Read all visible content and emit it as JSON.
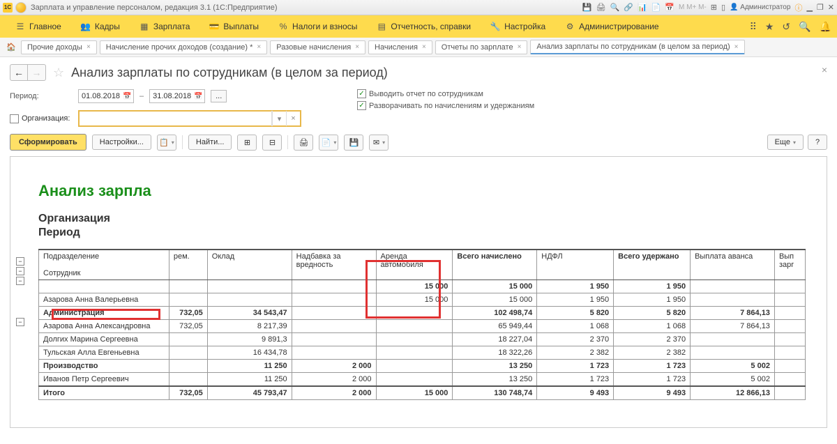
{
  "titlebar": {
    "logo": "1C",
    "title": "Зарплата и управление персоналом, редакция 3.1  (1С:Предприятие)",
    "user": "Администратор"
  },
  "mainmenu": {
    "items": [
      {
        "label": "Главное"
      },
      {
        "label": "Кадры"
      },
      {
        "label": "Зарплата"
      },
      {
        "label": "Выплаты"
      },
      {
        "label": "Налоги и взносы"
      },
      {
        "label": "Отчетность, справки"
      },
      {
        "label": "Настройка"
      },
      {
        "label": "Администрирование"
      }
    ]
  },
  "tabs": [
    {
      "label": "Прочие доходы"
    },
    {
      "label": "Начисление прочих доходов (создание) *"
    },
    {
      "label": "Разовые начисления"
    },
    {
      "label": "Начисления"
    },
    {
      "label": "Отчеты по зарплате"
    },
    {
      "label": "Анализ зарплаты по сотрудникам (в целом за период)",
      "active": true
    }
  ],
  "page": {
    "title": "Анализ зарплаты по сотрудникам (в целом за период)"
  },
  "params": {
    "period_label": "Период:",
    "date_from": "01.08.2018",
    "date_to": "31.08.2018",
    "org_label": "Организация:",
    "org_value": "",
    "chk1": "Выводить отчет по сотрудникам",
    "chk2": "Разворачивать по начислениям и удержаниям"
  },
  "toolbar": {
    "generate": "Сформировать",
    "settings": "Настройки...",
    "find": "Найти...",
    "more": "Еще"
  },
  "report": {
    "title": "Анализ зарпла",
    "org_label": "Организация",
    "period_label": "Период",
    "headers": {
      "dept": "Подразделение",
      "emp": "Сотрудник",
      "rem": "рем.",
      "oklad": "Оклад",
      "nadb": "Надбавка за вредность",
      "arenda": "Аренда автомобиля",
      "vsego_nach": "Всего начислено",
      "ndfl": "НДФЛ",
      "vsego_ud": "Всего удержано",
      "avans": "Выплата аванса",
      "vyp": "Вып зарг"
    },
    "rows": [
      {
        "name": "",
        "rem": "",
        "oklad": "",
        "nadb": "",
        "arenda": "15 000",
        "vsego_nach": "15 000",
        "ndfl": "1 950",
        "vsego_ud": "1 950",
        "avans": "",
        "bold": true
      },
      {
        "name": "Азарова Анна Валерьевна",
        "rem": "",
        "oklad": "",
        "nadb": "",
        "arenda": "15 000",
        "vsego_nach": "15 000",
        "ndfl": "1 950",
        "vsego_ud": "1 950",
        "avans": ""
      },
      {
        "name": "Администрация",
        "rem": "732,05",
        "oklad": "34 543,47",
        "nadb": "",
        "arenda": "",
        "vsego_nach": "102 498,74",
        "ndfl": "5 820",
        "vsego_ud": "5 820",
        "avans": "7 864,13",
        "bold": true
      },
      {
        "name": "Азарова Анна Александровна",
        "rem": "732,05",
        "oklad": "8 217,39",
        "nadb": "",
        "arenda": "",
        "vsego_nach": "65 949,44",
        "ndfl": "1 068",
        "vsego_ud": "1 068",
        "avans": "7 864,13"
      },
      {
        "name": "Долгих Марина Сергеевна",
        "rem": "",
        "oklad": "9 891,3",
        "nadb": "",
        "arenda": "",
        "vsego_nach": "18 227,04",
        "ndfl": "2 370",
        "vsego_ud": "2 370",
        "avans": ""
      },
      {
        "name": "Тульская Алла Евгеньевна",
        "rem": "",
        "oklad": "16 434,78",
        "nadb": "",
        "arenda": "",
        "vsego_nach": "18 322,26",
        "ndfl": "2 382",
        "vsego_ud": "2 382",
        "avans": ""
      },
      {
        "name": "Производство",
        "rem": "",
        "oklad": "11 250",
        "nadb": "2 000",
        "arenda": "",
        "vsego_nach": "13 250",
        "ndfl": "1 723",
        "vsego_ud": "1 723",
        "avans": "5 002",
        "bold": true
      },
      {
        "name": "Иванов Петр Сергеевич",
        "rem": "",
        "oklad": "11 250",
        "nadb": "2 000",
        "arenda": "",
        "vsego_nach": "13 250",
        "ndfl": "1 723",
        "vsego_ud": "1 723",
        "avans": "5 002"
      }
    ],
    "total": {
      "name": "Итого",
      "rem": "732,05",
      "oklad": "45 793,47",
      "nadb": "2 000",
      "arenda": "15 000",
      "vsego_nach": "130 748,74",
      "ndfl": "9 493",
      "vsego_ud": "9 493",
      "avans": "12 866,13"
    }
  }
}
